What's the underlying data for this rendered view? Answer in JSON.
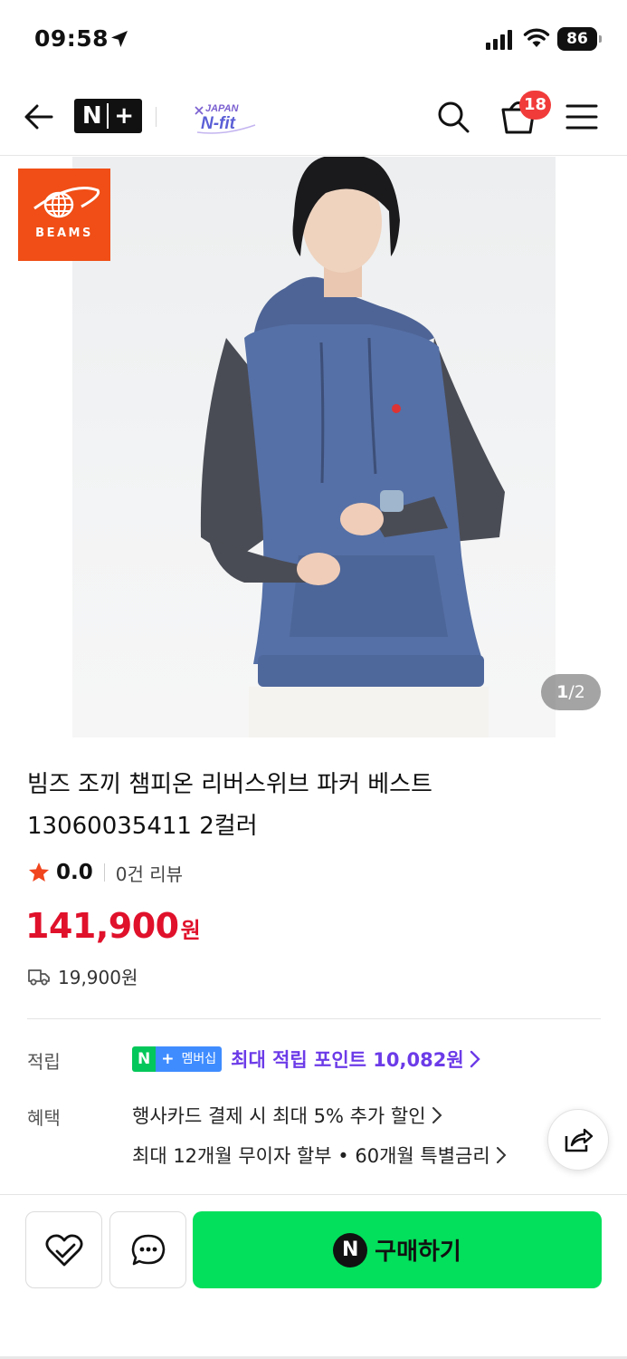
{
  "status_bar": {
    "time": "09:58",
    "battery": "86"
  },
  "header": {
    "cart_count": "18",
    "store_logo_text": "JAPAN N-fit"
  },
  "gallery": {
    "brand_logo_text": "BEAMS",
    "current": "1",
    "separator": "/",
    "total": "2"
  },
  "product": {
    "title_line1": "빔즈 조끼 챔피온 리버스위브 파커 베스트",
    "title_line2": "13060035411 2컬러",
    "rating": "0.0",
    "review_count": "0건 리뷰",
    "price": "141,900",
    "price_unit": "원",
    "shipping_fee": "19,900원"
  },
  "points": {
    "label": "적립",
    "badge_n": "N",
    "badge_plus": "+",
    "badge_membership": "멤버십",
    "text": "최대 적립 포인트 10,082원"
  },
  "benefits": {
    "label": "혜택",
    "line1": "행사카드 결제 시 최대 5% 추가 할인",
    "line2": "최대 12개월 무이자 할부 • 60개월 특별금리"
  },
  "bottom_bar": {
    "buy_icon_letter": "N",
    "buy_label": "구매하기"
  },
  "colors": {
    "price": "#e0112b",
    "buy_button": "#03e05b",
    "points_text": "#6c3be8",
    "brand_logo_bg": "#f04e16",
    "cart_badge": "#f13b3b"
  }
}
